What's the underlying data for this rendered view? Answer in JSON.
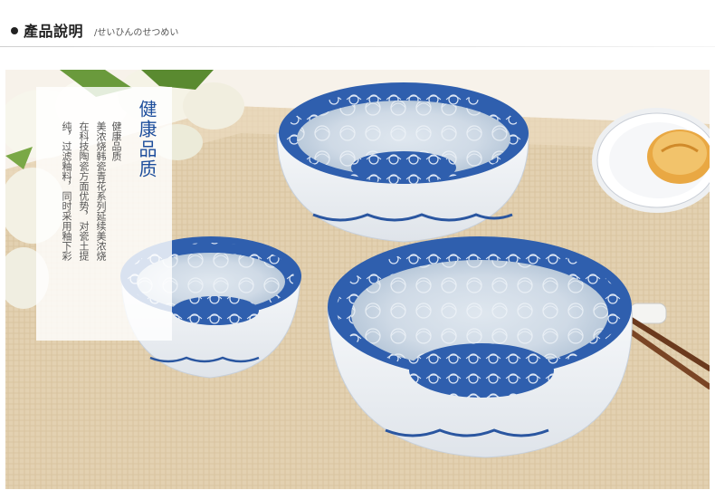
{
  "header": {
    "title": "產品說明",
    "subtitle": "/せいひんのせつめい"
  },
  "caption": {
    "title": "健康品质",
    "columns": [
      "健康品质",
      "美浓烧韩瓷青花系列延续美浓烧",
      "在科技陶瓷方面优势，对瓷土提",
      "纯，过滤釉料，同时采用釉下彩"
    ]
  },
  "colors": {
    "accent_blue": "#1d4e9c",
    "porcelain_white": "#f3f5f7",
    "tablecloth": "#e6d5b8",
    "chopsticks": "#6b3a1e"
  }
}
